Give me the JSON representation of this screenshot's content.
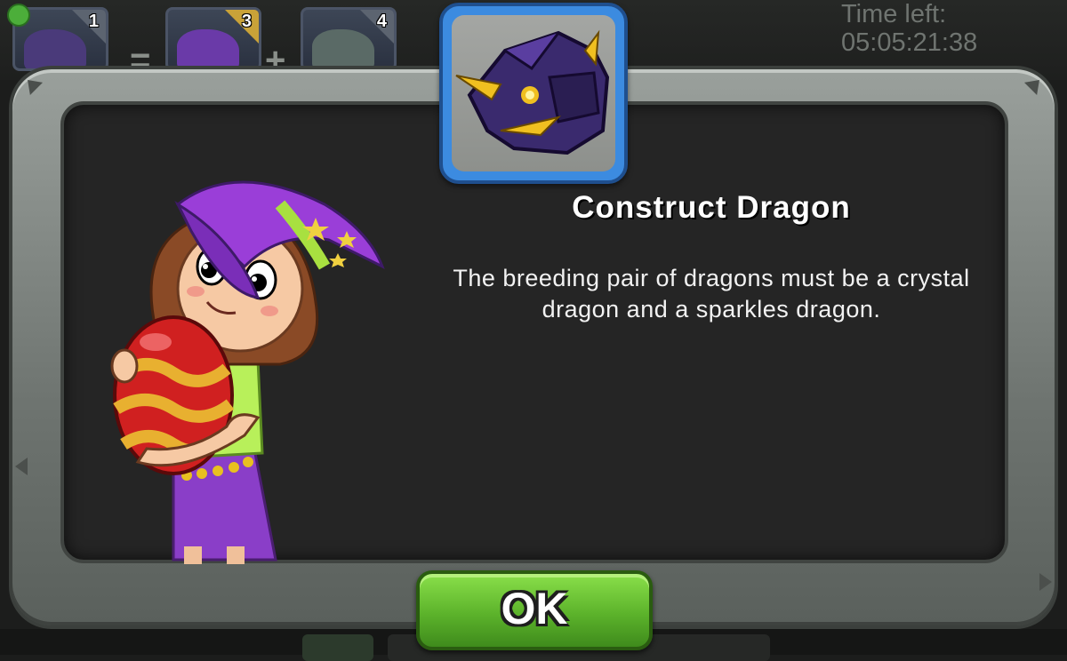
{
  "top_bar": {
    "slots": [
      {
        "number": "1",
        "corner": "gray"
      },
      {
        "number": "3",
        "corner": "gold"
      },
      {
        "number": "4",
        "corner": "gray"
      }
    ],
    "operators": [
      "=",
      "+"
    ],
    "timer_label": "Time left:",
    "timer_value": "05:05:21:38"
  },
  "dialog": {
    "dragon_image": "construct-dragon-portrait",
    "title": "Construct Dragon",
    "description": "The breeding pair of dragons must be a crystal dragon and a sparkles dragon.",
    "character": "witch-holding-egg",
    "ok_label": "OK"
  },
  "colors": {
    "frame": "#7a807c",
    "panel": "#252525",
    "card_border": "#3c8be0",
    "button": "#5cb32b",
    "dragon": "#3a2a6e",
    "dragon_glow": "#f0c020"
  }
}
